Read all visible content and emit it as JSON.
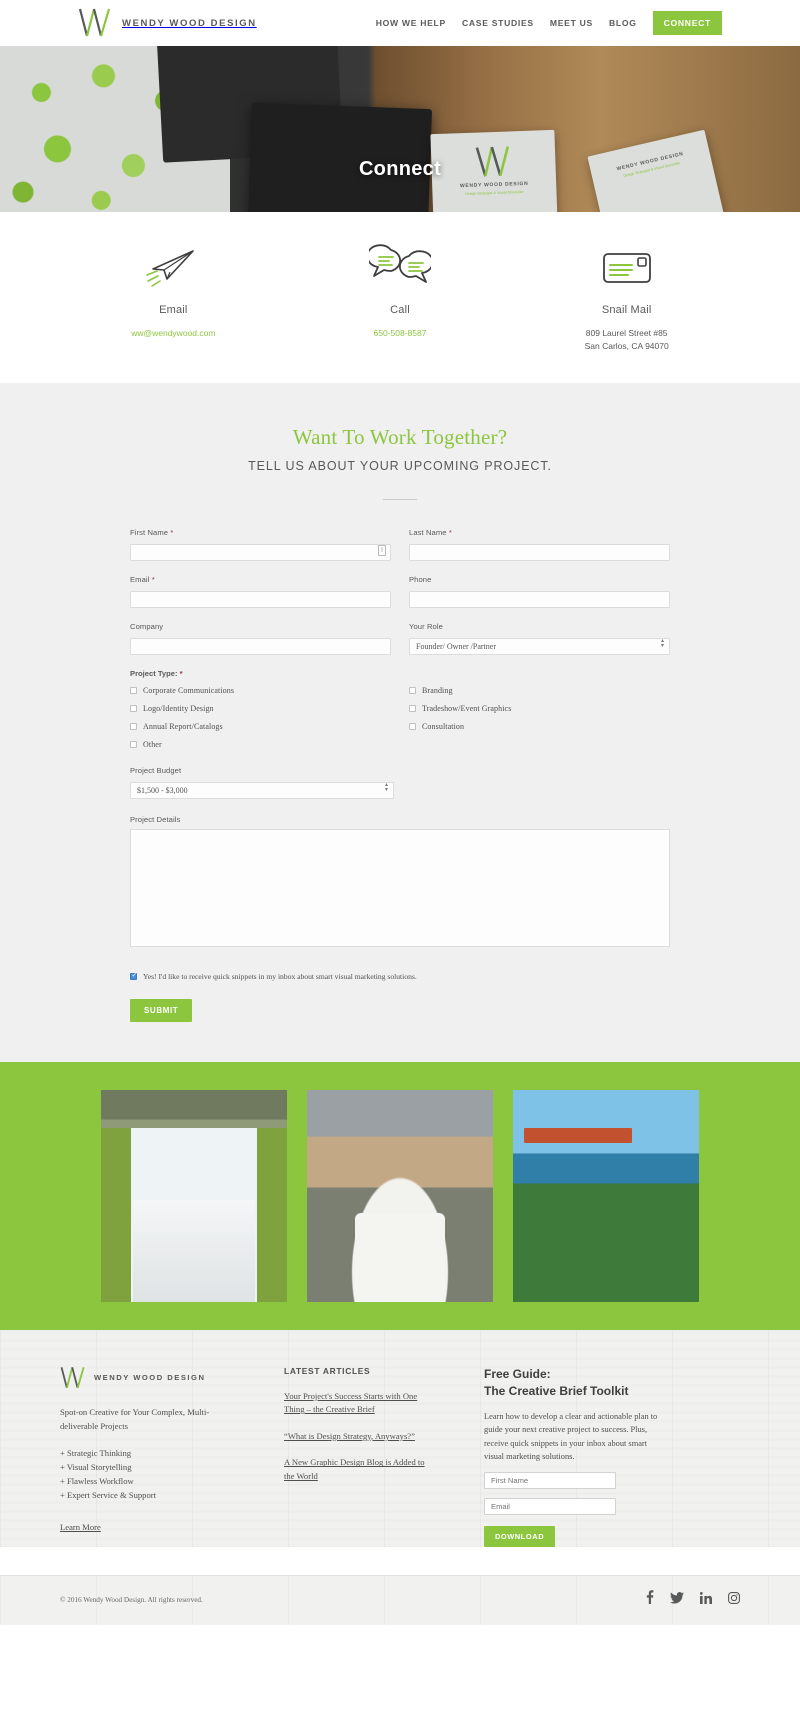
{
  "header": {
    "brand_name": "WENDY WOOD DESIGN",
    "logo_icon": "ww-monogram-logo",
    "nav": [
      {
        "label": "HOW WE HELP"
      },
      {
        "label": "CASE STUDIES"
      },
      {
        "label": "MEET US"
      },
      {
        "label": "BLOG"
      }
    ],
    "cta_label": "CONNECT",
    "accent_color": "#8cc63f"
  },
  "hero": {
    "title": "Connect",
    "card_brand": "WENDY WOOD DESIGN",
    "card_sub": "Design Strategist & Visual Storyteller"
  },
  "contact": [
    {
      "icon": "paper-plane-icon",
      "label": "Email",
      "value": "ww@wendywood.com",
      "value2": "",
      "style": "green"
    },
    {
      "icon": "speech-bubbles-icon",
      "label": "Call",
      "value": "650-508-8587",
      "value2": "",
      "style": "green"
    },
    {
      "icon": "envelope-icon",
      "label": "Snail Mail",
      "value": "809 Laurel Street #85",
      "value2": "San Carlos, CA 94070",
      "style": "dark"
    }
  ],
  "form": {
    "title": "Want To Work Together?",
    "subtitle": "TELL US ABOUT YOUR UPCOMING PROJECT.",
    "first_name": {
      "label": "First Name",
      "required": "*",
      "value": "",
      "placeholder": ""
    },
    "last_name": {
      "label": "Last Name",
      "required": "*",
      "value": "",
      "placeholder": ""
    },
    "email": {
      "label": "Email",
      "required": "*",
      "value": "",
      "placeholder": ""
    },
    "phone": {
      "label": "Phone",
      "required": "",
      "value": "",
      "placeholder": ""
    },
    "company": {
      "label": "Company",
      "required": "",
      "value": "",
      "placeholder": ""
    },
    "role": {
      "label": "Your Role",
      "selected": "Founder/ Owner /Partner",
      "options": [
        "Founder/ Owner /Partner"
      ]
    },
    "project_type": {
      "label": "Project Type:",
      "required": "*",
      "left_options": [
        {
          "label": "Corporate Communications",
          "checked": false
        },
        {
          "label": "Logo/Identity Design",
          "checked": false
        },
        {
          "label": "Annual Report/Catalogs",
          "checked": false
        },
        {
          "label": "Other",
          "checked": false
        }
      ],
      "right_options": [
        {
          "label": "Branding",
          "checked": false
        },
        {
          "label": "Tradeshow/Event Graphics",
          "checked": false
        },
        {
          "label": "Consultation",
          "checked": false
        }
      ]
    },
    "budget": {
      "label": "Project Budget",
      "selected": "$1,500 - $3,000",
      "options": [
        "$1,500 - $3,000"
      ]
    },
    "details": {
      "label": "Project Details",
      "value": "",
      "placeholder": ""
    },
    "consent": {
      "label": "Yes! I'd like to receive quick snippets in my inbox about smart visual marketing solutions.",
      "checked": true
    },
    "submit_label": "SUBMIT"
  },
  "gallery": [
    {
      "name": "studio-window-desk-photo"
    },
    {
      "name": "woman-mustache-mug-photo"
    },
    {
      "name": "golden-gate-bridge-photo"
    }
  ],
  "footer": {
    "brand_name": "WENDY WOOD DESIGN",
    "tagline": "Spot-on Creative for Your Complex, Multi-deliverable Projects",
    "bullets": [
      "+ Strategic Thinking",
      "+ Visual Storytelling",
      "+ Flawless Workflow",
      "+ Expert Service & Support"
    ],
    "learn_more": "Learn More",
    "articles_head": "LATEST ARTICLES",
    "articles": [
      "Your Project's Success Starts with One Thing – the Creative Brief",
      "“What is Design Strategy, Anyways?”",
      "A New Graphic Design Blog is Added to the World"
    ],
    "guide_title_1": "Free Guide:",
    "guide_title_2": "The Creative Brief Toolkit",
    "guide_body": "Learn how to develop a clear and actionable plan to guide your next creative project to success. Plus, receive quick snippets in your inbox about smart visual marketing solutions.",
    "guide_first_name_placeholder": "First Name",
    "guide_email_placeholder": "Email",
    "guide_btn_label": "DOWNLOAD",
    "copyright": "© 2016 Wendy Wood Design. All rights reserved.",
    "social": [
      {
        "name": "facebook-icon"
      },
      {
        "name": "twitter-icon"
      },
      {
        "name": "linkedin-icon"
      },
      {
        "name": "instagram-icon"
      }
    ]
  }
}
